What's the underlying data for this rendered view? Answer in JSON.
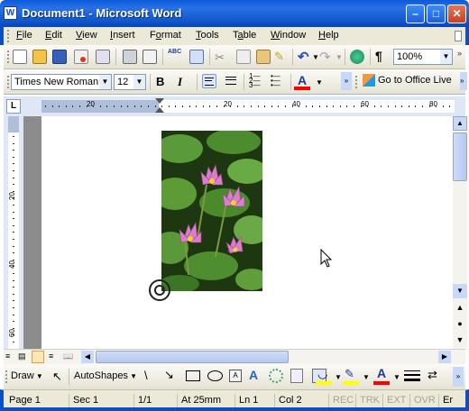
{
  "window": {
    "title": "Document1 - Microsoft Word",
    "app_icon": "W"
  },
  "menu": [
    {
      "label": "File",
      "key": "F"
    },
    {
      "label": "Edit",
      "key": "E"
    },
    {
      "label": "View",
      "key": "V"
    },
    {
      "label": "Insert",
      "key": "I"
    },
    {
      "label": "Format",
      "key": "o"
    },
    {
      "label": "Tools",
      "key": "T"
    },
    {
      "label": "Table",
      "key": "a"
    },
    {
      "label": "Window",
      "key": "W"
    },
    {
      "label": "Help",
      "key": "H"
    }
  ],
  "standard_toolbar": {
    "zoom": "100%",
    "pilcrow": "¶"
  },
  "formatting_toolbar": {
    "font": "Times New Roman",
    "size": "12",
    "bold": "B",
    "italic": "I",
    "font_color_label": "A",
    "office_live": "Go to Office Live"
  },
  "ruler": {
    "h_numbers": [
      "20",
      "20",
      "40",
      "60",
      "80"
    ],
    "v_numbers": [
      "20",
      "40",
      "60"
    ],
    "corner": "L"
  },
  "drawing_toolbar": {
    "draw": "Draw",
    "autoshapes": "AutoShapes",
    "font_color_label": "A"
  },
  "status": {
    "page": "Page 1",
    "sec": "Sec 1",
    "pages": "1/1",
    "at": "At 25mm",
    "ln": "Ln 1",
    "col": "Col 2",
    "rec": "REC",
    "trk": "TRK",
    "ext": "EXT",
    "ovr": "OVR",
    "lang": "Er"
  },
  "colors": {
    "title_blue": "#0a5bd9",
    "chrome": "#ece9d8",
    "highlight_yellow": "#ffff00",
    "font_color_red": "#ff0000"
  }
}
